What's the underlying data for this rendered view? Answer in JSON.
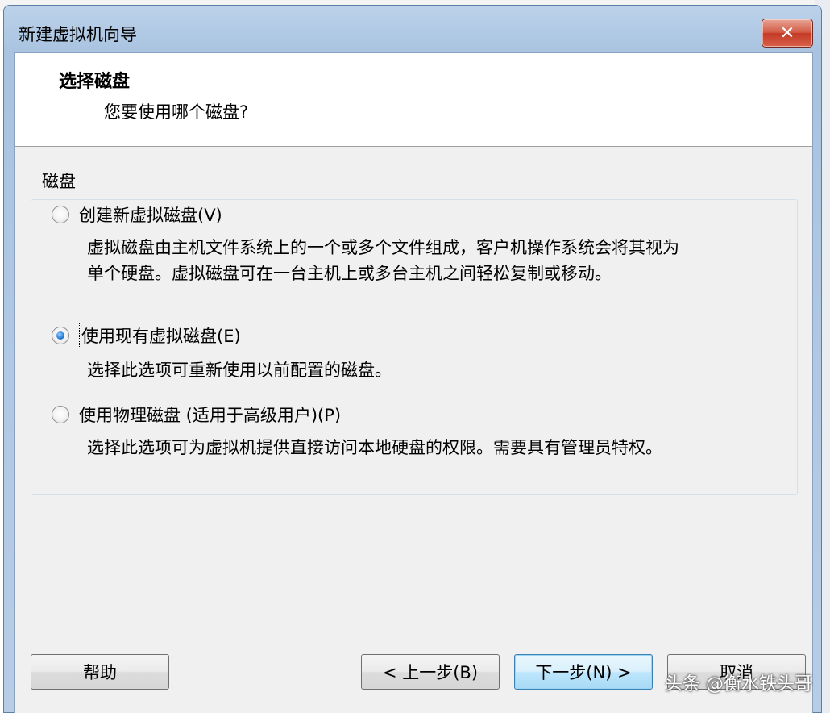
{
  "window": {
    "title": "新建虚拟机向导",
    "close_label": "✕"
  },
  "header": {
    "title": "选择磁盘",
    "subtitle": "您要使用哪个磁盘?"
  },
  "group": {
    "label": "磁盘"
  },
  "options": [
    {
      "label": "创建新虚拟磁盘(V)",
      "checked": false,
      "description_lines": [
        "虚拟磁盘由主机文件系统上的一个或多个文件组成，客户机操作系统会将其视为",
        "单个硬盘。虚拟磁盘可在一台主机上或多台主机之间轻松复制或移动。"
      ]
    },
    {
      "label": "使用现有虚拟磁盘(E)",
      "checked": true,
      "description_lines": [
        "选择此选项可重新使用以前配置的磁盘。"
      ]
    },
    {
      "label": "使用物理磁盘 (适用于高级用户)(P)",
      "checked": false,
      "description_lines": [
        "选择此选项可为虚拟机提供直接访问本地硬盘的权限。需要具有管理员特权。"
      ]
    }
  ],
  "buttons": {
    "help": "帮助",
    "back": "< 上一步(B)",
    "next": "下一步(N) >",
    "cancel": "取消"
  },
  "watermark": "头条 @衡水铁头哥"
}
